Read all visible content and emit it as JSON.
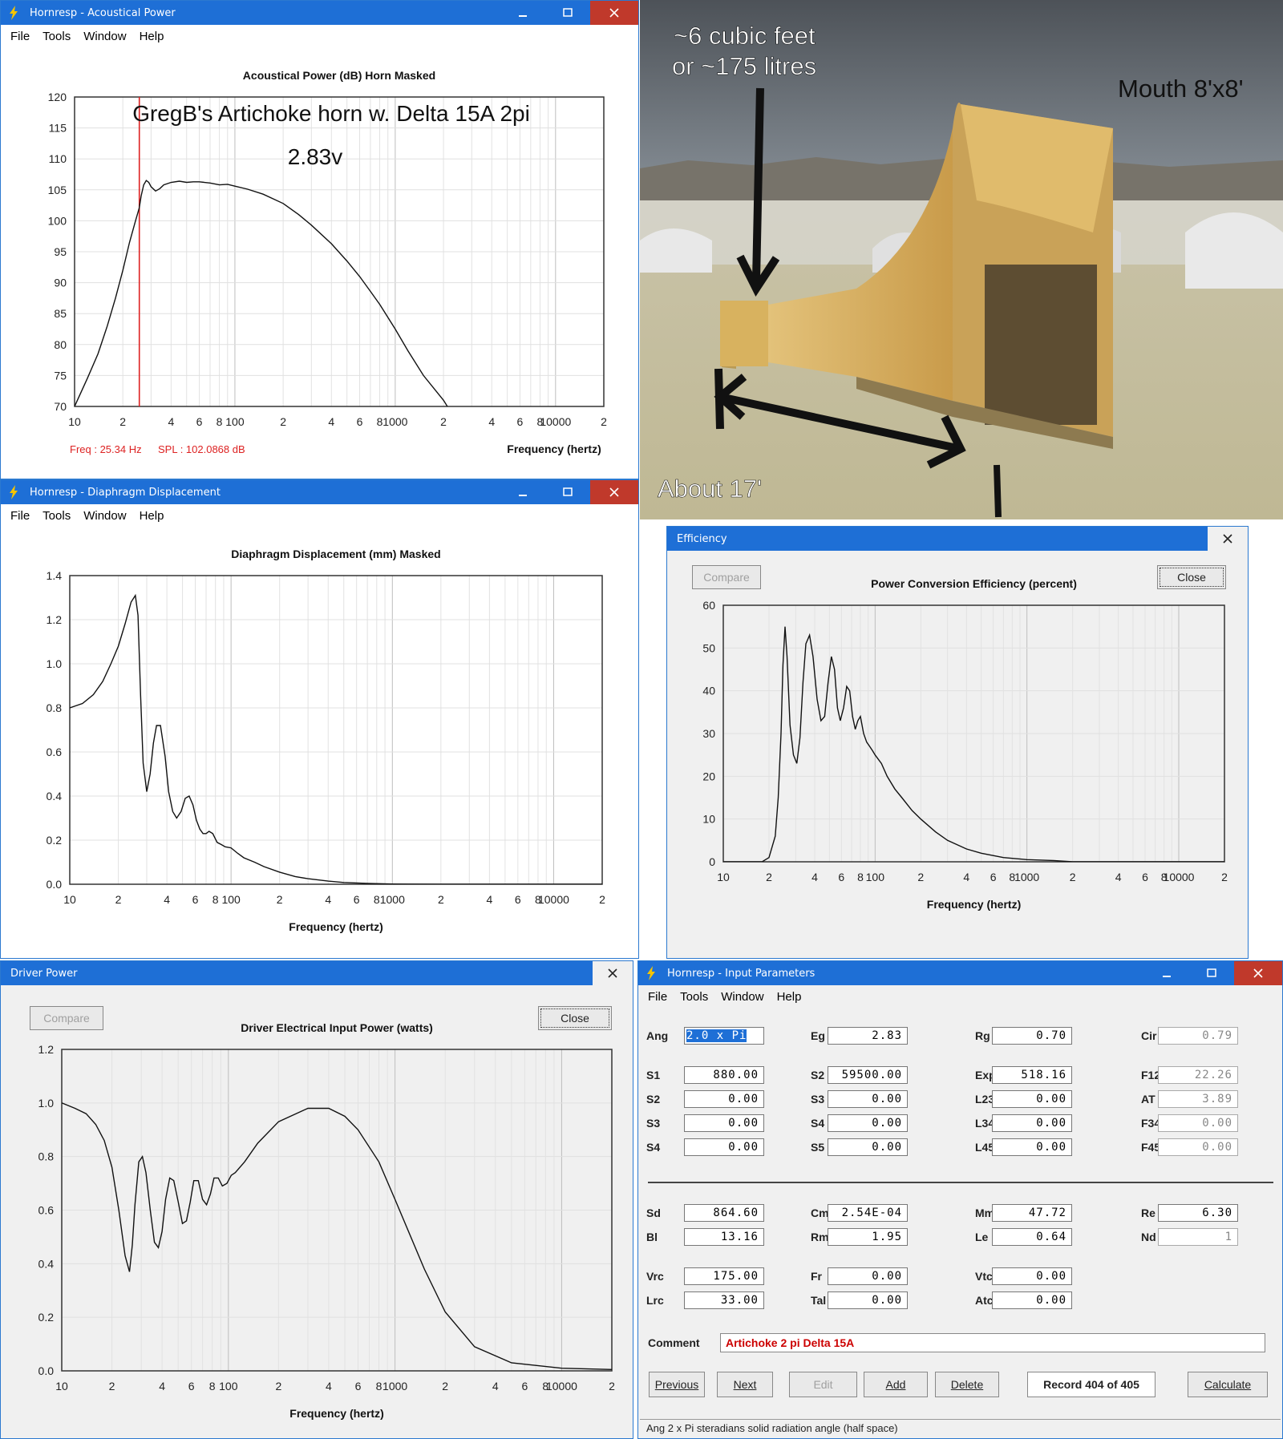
{
  "colors": {
    "title_bar": "#1e6fd6",
    "close_button": "#c0392b",
    "cursor_line": "#dd2222",
    "curve": "#111111",
    "comment_text": "#cc0000"
  },
  "acoustic": {
    "title": "Hornresp - Acoustical Power",
    "menu": [
      "File",
      "Tools",
      "Window",
      "Help"
    ],
    "chart_title": "Acoustical Power (dB)   Horn   Masked",
    "annotation1": "GregB's Artichoke horn w. Delta 15A 2pi",
    "annotation2": "2.83v",
    "readout_freq": "Freq : 25.34 Hz",
    "readout_spl": "SPL : 102.0868 dB",
    "xlabel": "Frequency (hertz)"
  },
  "displacement": {
    "title": "Hornresp - Diaphragm Displacement",
    "menu": [
      "File",
      "Tools",
      "Window",
      "Help"
    ],
    "chart_title": "Diaphragm Displacement (mm)   Masked",
    "xlabel": "Frequency (hertz)"
  },
  "efficiency": {
    "title": "Efficiency",
    "compare": "Compare",
    "close": "Close",
    "chart_title": "Power Conversion Efficiency (percent)",
    "xlabel": "Frequency (hertz)"
  },
  "driver_power": {
    "title": "Driver Power",
    "compare": "Compare",
    "close": "Close",
    "chart_title": "Driver Electrical Input Power (watts)",
    "xlabel": "Frequency (hertz)"
  },
  "photo": {
    "label_volume1": "~6 cubic feet",
    "label_volume2": "or ~175 litres",
    "label_mouth": "Mouth 8'x8'",
    "label_length": "About 17'"
  },
  "params": {
    "title": "Hornresp - Input Parameters",
    "menu": [
      "File",
      "Tools",
      "Window",
      "Help"
    ],
    "rows1": [
      [
        {
          "l": "Ang",
          "v": "2.0 x Pi",
          "sel": true
        },
        {
          "l": "Eg",
          "v": "2.83"
        },
        {
          "l": "Rg",
          "v": "0.70"
        },
        {
          "l": "Cir",
          "v": "0.79",
          "grey": true
        }
      ]
    ],
    "rows2": [
      [
        {
          "l": "S1",
          "v": "880.00"
        },
        {
          "l": "S2",
          "v": "59500.00"
        },
        {
          "l": "Exp",
          "v": "518.16"
        },
        {
          "l": "F12",
          "v": "22.26",
          "grey": true
        }
      ],
      [
        {
          "l": "S2",
          "v": "0.00"
        },
        {
          "l": "S3",
          "v": "0.00"
        },
        {
          "l": "L23",
          "v": "0.00"
        },
        {
          "l": "AT",
          "v": "3.89",
          "grey": true
        }
      ],
      [
        {
          "l": "S3",
          "v": "0.00"
        },
        {
          "l": "S4",
          "v": "0.00"
        },
        {
          "l": "L34",
          "v": "0.00"
        },
        {
          "l": "F34",
          "v": "0.00",
          "grey": true
        }
      ],
      [
        {
          "l": "S4",
          "v": "0.00"
        },
        {
          "l": "S5",
          "v": "0.00"
        },
        {
          "l": "L45",
          "v": "0.00"
        },
        {
          "l": "F45",
          "v": "0.00",
          "grey": true
        }
      ]
    ],
    "rows3": [
      [
        {
          "l": "Sd",
          "v": "864.60"
        },
        {
          "l": "Cms",
          "v": "2.54E-04"
        },
        {
          "l": "Mmd",
          "v": "47.72"
        },
        {
          "l": "Re",
          "v": "6.30"
        }
      ],
      [
        {
          "l": "Bl",
          "v": "13.16"
        },
        {
          "l": "Rms",
          "v": "1.95"
        },
        {
          "l": "Le",
          "v": "0.64"
        },
        {
          "l": "Nd",
          "v": "1",
          "grey": true
        }
      ]
    ],
    "rows4": [
      [
        {
          "l": "Vrc",
          "v": "175.00"
        },
        {
          "l": "Fr",
          "v": "0.00"
        },
        {
          "l": "Vtc",
          "v": "0.00"
        }
      ],
      [
        {
          "l": "Lrc",
          "v": "33.00"
        },
        {
          "l": "Tal",
          "v": "0.00"
        },
        {
          "l": "Atc",
          "v": "0.00"
        }
      ]
    ],
    "comment_label": "Comment",
    "comment": "Artichoke 2 pi Delta 15A",
    "buttons": {
      "previous": "Previous",
      "next": "Next",
      "edit": "Edit",
      "add": "Add",
      "delete": "Delete",
      "record": "Record 404 of 405",
      "calculate": "Calculate"
    },
    "status": "Ang   2 x Pi steradians solid radiation angle  (half space)"
  },
  "chart_data": [
    {
      "id": "acoustical_power",
      "type": "line",
      "title": "Acoustical Power (dB)   Horn   Masked",
      "xlabel": "Frequency (hertz)",
      "ylabel": "",
      "xscale": "log",
      "xlim": [
        10,
        20000
      ],
      "ylim": [
        70,
        120
      ],
      "yticks": [
        70,
        75,
        80,
        85,
        90,
        95,
        100,
        105,
        110,
        115,
        120
      ],
      "xtick_labels": [
        [
          "10",
          10
        ],
        [
          "2",
          20
        ],
        [
          "4",
          40
        ],
        [
          "6",
          60
        ],
        [
          "8",
          80
        ],
        [
          "100",
          100
        ],
        [
          "2",
          200
        ],
        [
          "4",
          400
        ],
        [
          "6",
          600
        ],
        [
          "8",
          800
        ],
        [
          "1000",
          1000
        ],
        [
          "2",
          2000
        ],
        [
          "4",
          4000
        ],
        [
          "6",
          6000
        ],
        [
          "8",
          8000
        ],
        [
          "10000",
          10000
        ],
        [
          "2",
          20000
        ]
      ],
      "marker_x": 25.34,
      "x": [
        10,
        12,
        14,
        16,
        18,
        20,
        22,
        24,
        25.34,
        26,
        27,
        28,
        29,
        30,
        32,
        34,
        36,
        40,
        45,
        50,
        55,
        60,
        70,
        80,
        90,
        100,
        120,
        150,
        200,
        250,
        300,
        400,
        500,
        600,
        700,
        800,
        1000,
        1200,
        1500,
        2000,
        2500,
        3000,
        3500
      ],
      "y": [
        70,
        74.5,
        78.5,
        83,
        87.5,
        92,
        96.5,
        100,
        102.1,
        104,
        105.8,
        106.5,
        106.2,
        105.5,
        104.8,
        105.2,
        105.8,
        106.2,
        106.4,
        106.2,
        106.3,
        106.3,
        106.1,
        105.8,
        105.9,
        105.6,
        105.1,
        104.3,
        102.8,
        101,
        99.3,
        96.3,
        93.5,
        91,
        88.6,
        86.5,
        82.5,
        79,
        75,
        71,
        67,
        63,
        60
      ]
    },
    {
      "id": "diaphragm_displacement",
      "type": "line",
      "title": "Diaphragm Displacement (mm)   Masked",
      "xlabel": "Frequency (hertz)",
      "ylabel": "",
      "xscale": "log",
      "xlim": [
        10,
        20000
      ],
      "ylim": [
        0,
        1.4
      ],
      "yticks": [
        0.0,
        0.2,
        0.4,
        0.6,
        0.8,
        1.0,
        1.2,
        1.4
      ],
      "xtick_labels": [
        [
          "10",
          10
        ],
        [
          "2",
          20
        ],
        [
          "4",
          40
        ],
        [
          "6",
          60
        ],
        [
          "8",
          80
        ],
        [
          "100",
          100
        ],
        [
          "2",
          200
        ],
        [
          "4",
          400
        ],
        [
          "6",
          600
        ],
        [
          "8",
          800
        ],
        [
          "1000",
          1000
        ],
        [
          "2",
          2000
        ],
        [
          "4",
          4000
        ],
        [
          "6",
          6000
        ],
        [
          "8",
          8000
        ],
        [
          "10000",
          10000
        ],
        [
          "2",
          20000
        ]
      ],
      "x": [
        10,
        12,
        14,
        16,
        18,
        20,
        22,
        24,
        25.5,
        26.5,
        27.5,
        28.5,
        30,
        31.5,
        33,
        34.5,
        36.5,
        39,
        41,
        43.5,
        46,
        49,
        52,
        55,
        58,
        61,
        64,
        67,
        70,
        73,
        77,
        82,
        87,
        92,
        100,
        110,
        120,
        140,
        160,
        200,
        250,
        300,
        400,
        500,
        700,
        1000,
        2000,
        5000,
        20000
      ],
      "y": [
        0.8,
        0.82,
        0.86,
        0.92,
        1.0,
        1.08,
        1.18,
        1.28,
        1.31,
        1.22,
        0.85,
        0.55,
        0.42,
        0.5,
        0.64,
        0.72,
        0.72,
        0.58,
        0.42,
        0.33,
        0.3,
        0.33,
        0.39,
        0.4,
        0.36,
        0.29,
        0.25,
        0.23,
        0.23,
        0.24,
        0.23,
        0.19,
        0.18,
        0.17,
        0.165,
        0.14,
        0.12,
        0.1,
        0.08,
        0.055,
        0.035,
        0.025,
        0.014,
        0.008,
        0.004,
        0.001,
        0,
        0,
        0
      ]
    },
    {
      "id": "power_conversion_efficiency",
      "type": "line",
      "title": "Power Conversion Efficiency (percent)",
      "xlabel": "Frequency (hertz)",
      "ylabel": "",
      "xscale": "log",
      "xlim": [
        10,
        20000
      ],
      "ylim": [
        0,
        60
      ],
      "yticks": [
        0,
        10,
        20,
        30,
        40,
        50,
        60
      ],
      "xtick_labels": [
        [
          "10",
          10
        ],
        [
          "2",
          20
        ],
        [
          "4",
          40
        ],
        [
          "6",
          60
        ],
        [
          "8",
          80
        ],
        [
          "100",
          100
        ],
        [
          "2",
          200
        ],
        [
          "4",
          400
        ],
        [
          "6",
          600
        ],
        [
          "8",
          800
        ],
        [
          "1000",
          1000
        ],
        [
          "2",
          2000
        ],
        [
          "4",
          4000
        ],
        [
          "6",
          6000
        ],
        [
          "8",
          8000
        ],
        [
          "10000",
          10000
        ],
        [
          "2",
          20000
        ]
      ],
      "x": [
        10,
        18,
        20,
        22,
        23,
        24,
        24.7,
        25.5,
        26.3,
        27.5,
        29,
        30.5,
        32,
        33.5,
        35,
        37,
        39,
        41.5,
        44,
        46.5,
        49,
        51.5,
        54,
        56.5,
        59,
        62,
        65,
        68,
        71,
        74,
        77,
        80,
        84,
        88,
        92,
        96,
        100,
        110,
        120,
        135,
        150,
        175,
        200,
        250,
        300,
        400,
        500,
        700,
        1000,
        1500,
        2000,
        5000,
        20000
      ],
      "y": [
        0,
        0,
        1,
        6,
        15,
        30,
        46,
        55,
        48,
        32,
        25,
        23,
        29,
        42,
        51,
        53,
        48,
        38,
        33,
        34,
        42,
        48,
        45,
        36,
        33,
        36,
        41,
        40,
        34,
        31,
        33,
        34,
        30,
        28,
        27,
        26,
        25,
        23,
        20,
        17,
        15,
        12,
        10,
        7,
        5,
        3,
        2,
        1,
        0.5,
        0.3,
        0,
        0,
        0
      ]
    },
    {
      "id": "driver_electrical_input_power",
      "type": "line",
      "title": "Driver Electrical Input Power (watts)",
      "xlabel": "Frequency (hertz)",
      "ylabel": "",
      "xscale": "log",
      "xlim": [
        10,
        20000
      ],
      "ylim": [
        0,
        1.2
      ],
      "yticks": [
        0.0,
        0.2,
        0.4,
        0.6,
        0.8,
        1.0,
        1.2
      ],
      "xtick_labels": [
        [
          "10",
          10
        ],
        [
          "2",
          20
        ],
        [
          "4",
          40
        ],
        [
          "6",
          60
        ],
        [
          "8",
          80
        ],
        [
          "100",
          100
        ],
        [
          "2",
          200
        ],
        [
          "4",
          400
        ],
        [
          "6",
          600
        ],
        [
          "8",
          800
        ],
        [
          "1000",
          1000
        ],
        [
          "2",
          2000
        ],
        [
          "4",
          4000
        ],
        [
          "6",
          6000
        ],
        [
          "8",
          8000
        ],
        [
          "10000",
          10000
        ],
        [
          "2",
          20000
        ]
      ],
      "x": [
        10,
        12,
        14,
        16,
        18,
        20,
        22,
        24,
        25.5,
        26.5,
        27.5,
        29,
        30.5,
        32,
        34,
        36,
        38,
        40,
        42,
        44.5,
        47,
        50,
        53,
        56,
        59,
        62,
        66,
        70,
        74,
        78,
        82,
        87,
        92,
        98,
        104,
        110,
        125,
        150,
        200,
        300,
        400,
        500,
        600,
        800,
        1000,
        1500,
        2000,
        3000,
        5000,
        10000,
        20000
      ],
      "y": [
        1.0,
        0.98,
        0.96,
        0.92,
        0.86,
        0.76,
        0.6,
        0.43,
        0.37,
        0.47,
        0.62,
        0.78,
        0.8,
        0.74,
        0.6,
        0.48,
        0.46,
        0.52,
        0.64,
        0.72,
        0.71,
        0.63,
        0.55,
        0.56,
        0.63,
        0.71,
        0.71,
        0.64,
        0.62,
        0.66,
        0.72,
        0.72,
        0.69,
        0.7,
        0.73,
        0.74,
        0.78,
        0.85,
        0.93,
        0.98,
        0.98,
        0.95,
        0.9,
        0.78,
        0.64,
        0.38,
        0.22,
        0.09,
        0.03,
        0.01,
        0.005
      ]
    }
  ]
}
